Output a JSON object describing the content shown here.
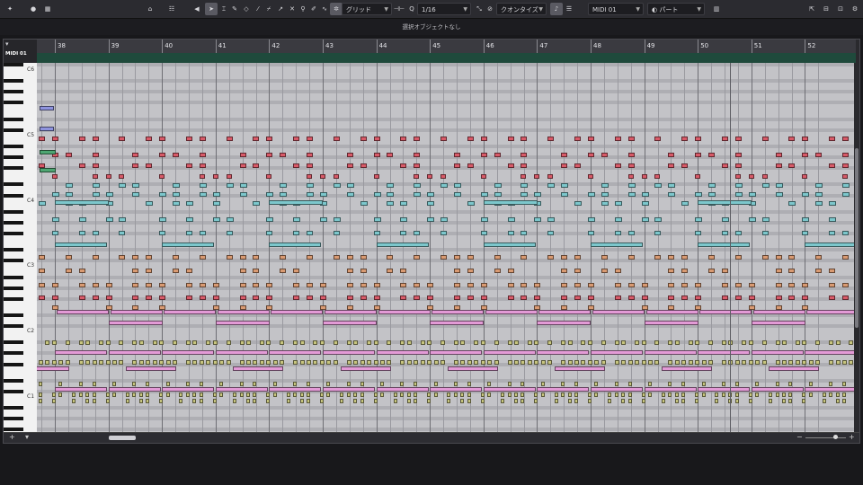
{
  "toolbar": {
    "grid_label": "グリッド",
    "quantize_value": "1/16",
    "quantize_label": "クオンタイズ",
    "track_select": "MIDI 01",
    "part_label": "パート",
    "icons": [
      "toggle-inspector-icon",
      "record-icon",
      "metronome-icon",
      "lane-display-icon",
      "select-tool-icon",
      "pencil-icon",
      "eraser-icon",
      "trim-icon",
      "split-icon",
      "glue-icon",
      "mute-x-icon",
      "zoom-icon",
      "color-icon",
      "line-tool-icon",
      "snap-icon",
      "quantize-icon",
      "legato-icon",
      "step-input-icon",
      "color-scheme-icon",
      "window-layout-icon"
    ]
  },
  "status": {
    "text": "選択オブジェクトなし"
  },
  "editor": {
    "track_name": "MIDI 01",
    "bars": [
      "38",
      "39",
      "40",
      "41",
      "42",
      "43",
      "44",
      "45",
      "46",
      "47",
      "48",
      "49",
      "50",
      "51",
      "52"
    ],
    "octave_labels": [
      "C6",
      "C5",
      "C4",
      "C3",
      "C2",
      "C1"
    ]
  },
  "colors": {
    "teal": "#7cc7cc",
    "red": "#d85a68",
    "orange": "#d99a72",
    "pink": "#e39ad6",
    "olive": "#c7c57e",
    "green": "#4ea672",
    "blue": "#8e93de"
  }
}
